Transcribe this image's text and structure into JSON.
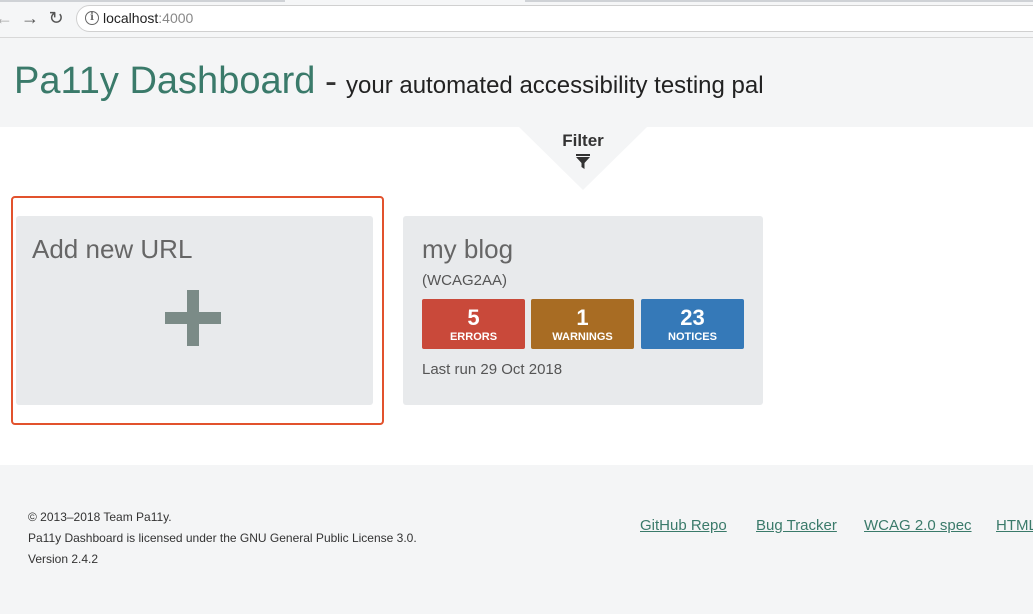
{
  "browser": {
    "url_host": "localhost",
    "url_port": ":4000"
  },
  "header": {
    "title": "Pa11y Dashboard",
    "dash": "-",
    "tagline": "your automated accessibility testing pal"
  },
  "filter": {
    "label": "Filter"
  },
  "add_card": {
    "heading": "Add new URL"
  },
  "site_card": {
    "name": "my blog",
    "standard": "(WCAG2AA)",
    "errors": {
      "count": "5",
      "label": "ERRORS",
      "color": "#c9493a"
    },
    "warnings": {
      "count": "1",
      "label": "WARNINGS",
      "color": "#a86c23"
    },
    "notices": {
      "count": "23",
      "label": "NOTICES",
      "color": "#3579b8"
    },
    "last_run": "Last run 29 Oct 2018"
  },
  "footer": {
    "copyright": "© 2013–2018 Team Pa11y.",
    "license": "Pa11y Dashboard is licensed under the GNU General Public License 3.0.",
    "version": "Version 2.4.2",
    "links": [
      "GitHub Repo",
      "Bug Tracker",
      "WCAG 2.0 spec",
      "HTML"
    ]
  },
  "colors": {
    "brand": "#3a7a6a",
    "highlight": "#e2522d"
  }
}
